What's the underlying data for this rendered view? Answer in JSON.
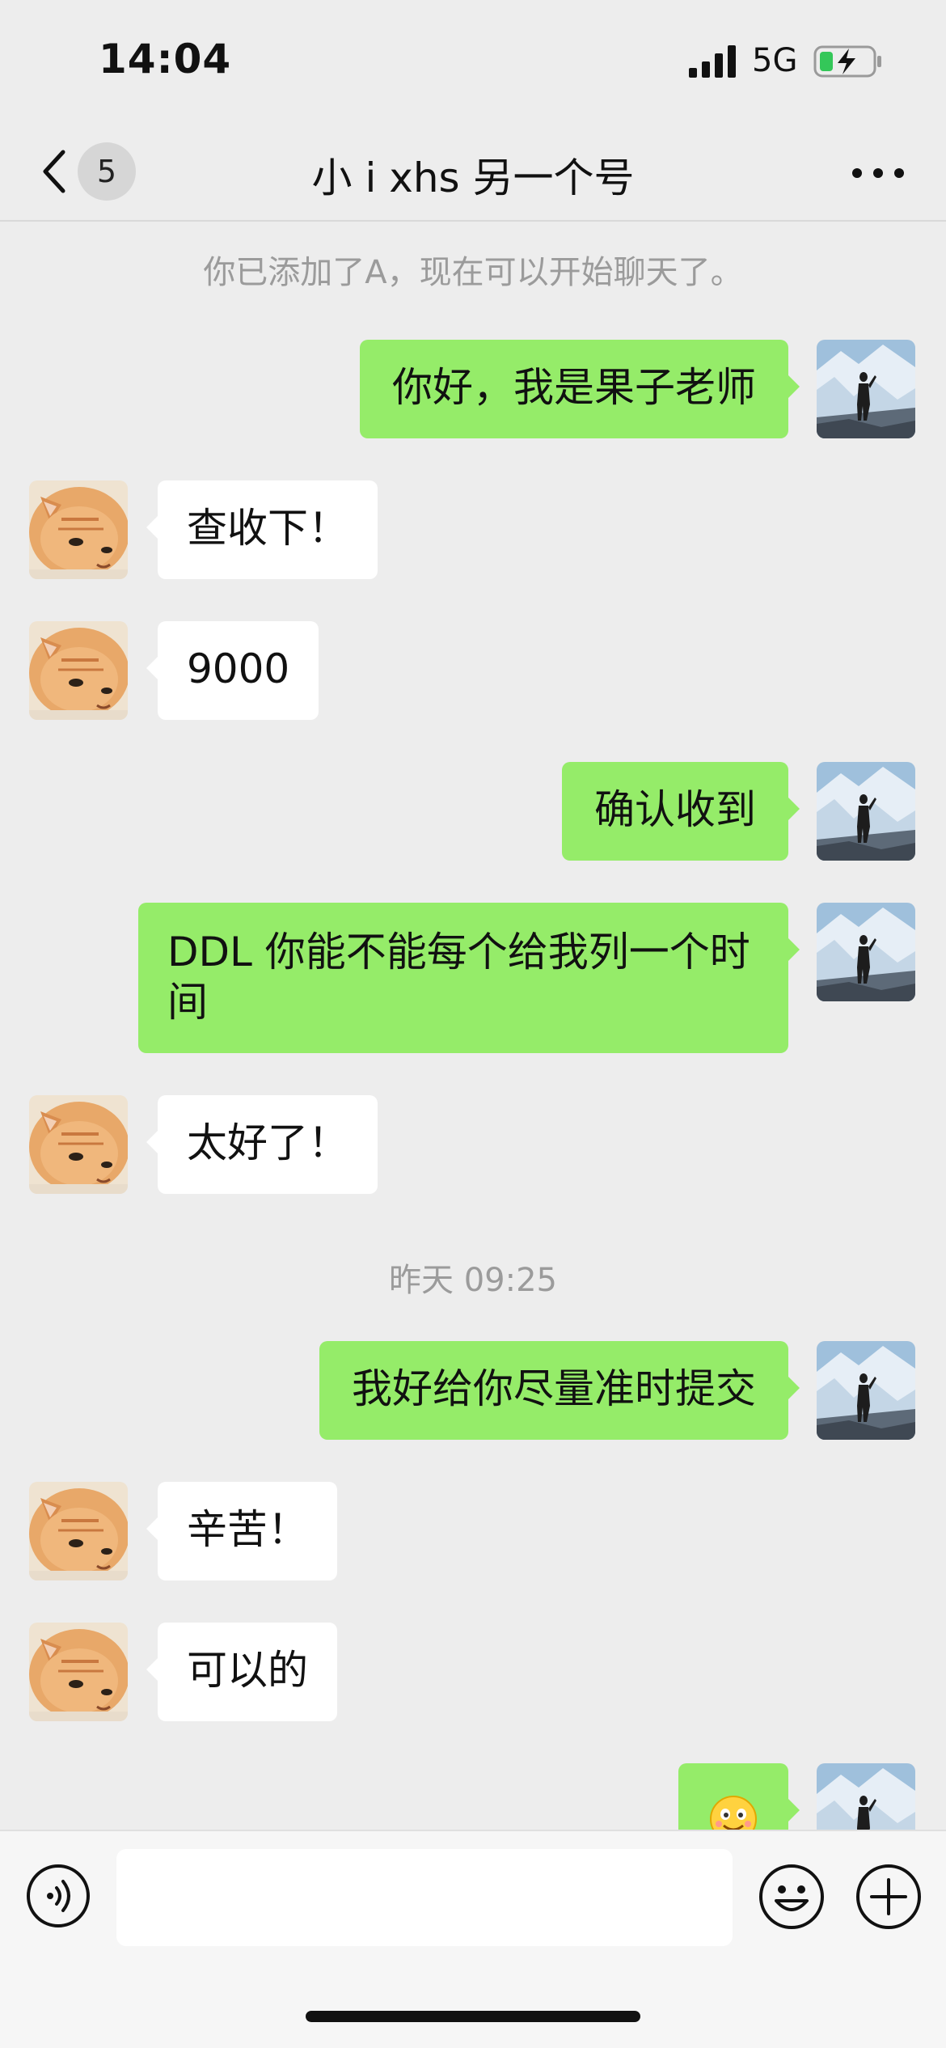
{
  "status_bar": {
    "time": "14:04",
    "network": "5G",
    "icons": [
      "signal-icon",
      "battery-charging-icon"
    ]
  },
  "header": {
    "back_icon": "chevron-left-icon",
    "unread_count": "5",
    "title": "小 i xhs 另一个号",
    "more_icon": "more-dots-icon"
  },
  "chat": {
    "system_notice": "你已添加了A，现在可以开始聊天了。",
    "messages": [
      {
        "from": "me",
        "text": "你好，我是果子老师"
      },
      {
        "from": "other",
        "text": "查收下！"
      },
      {
        "from": "other",
        "text": "9000"
      },
      {
        "from": "me",
        "text": "确认收到"
      },
      {
        "from": "me",
        "text": "DDL 你能不能每个给我列一个时间"
      },
      {
        "from": "other",
        "text": "太好了！"
      },
      {
        "from": "me",
        "text": "我好给你尽量准时提交"
      },
      {
        "from": "other",
        "text": "辛苦！"
      },
      {
        "from": "other",
        "text": "可以的"
      },
      {
        "from": "me",
        "text": "",
        "emoji": "smile-thumbs-up-emoji"
      }
    ],
    "time_divider": "昨天 09:25"
  },
  "input_bar": {
    "message_value": "",
    "icons": [
      "voice-icon",
      "emoji-icon",
      "plus-icon"
    ]
  },
  "colors": {
    "background": "#ededed",
    "my_bubble": "#95ec69",
    "other_bubble": "#ffffff",
    "muted_text": "#9b9b9b"
  }
}
